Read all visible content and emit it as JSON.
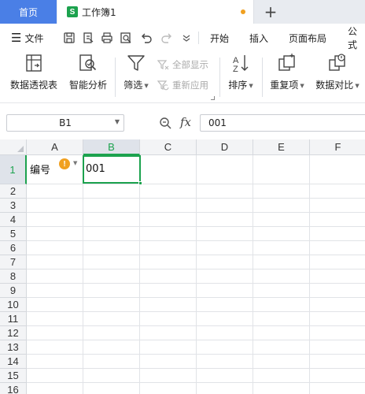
{
  "tabs": {
    "home_label": "首页",
    "workbook_label": "工作簿1",
    "workbook_icon_letter": "S",
    "add_label": "+"
  },
  "menu": {
    "file_label": "文件",
    "items": [
      "开始",
      "插入",
      "页面布局",
      "公式"
    ]
  },
  "ribbon": {
    "pivot_label": "数据透视表",
    "smart_label": "智能分析",
    "filter_label": "筛选",
    "show_all_label": "全部显示",
    "reapply_label": "重新应用",
    "sort_label": "排序",
    "duplicates_label": "重复项",
    "compare_label": "数据对比"
  },
  "formula_bar": {
    "name_box": "B1",
    "fx_label": "fx",
    "value": "001"
  },
  "sheet": {
    "columns": [
      "A",
      "B",
      "C",
      "D",
      "E",
      "F"
    ],
    "active_column": "B",
    "rows": [
      "1",
      "2",
      "3",
      "4",
      "5",
      "6",
      "7",
      "8",
      "9",
      "10",
      "11",
      "12",
      "13",
      "14",
      "15",
      "16"
    ],
    "active_row": "1",
    "cells": {
      "A1": "编号",
      "B1": "001"
    },
    "warning_symbol": "!"
  },
  "colors": {
    "accent_green": "#1ca24e",
    "home_tab_blue": "#4a7fe6",
    "warning_orange": "#f0a020"
  }
}
